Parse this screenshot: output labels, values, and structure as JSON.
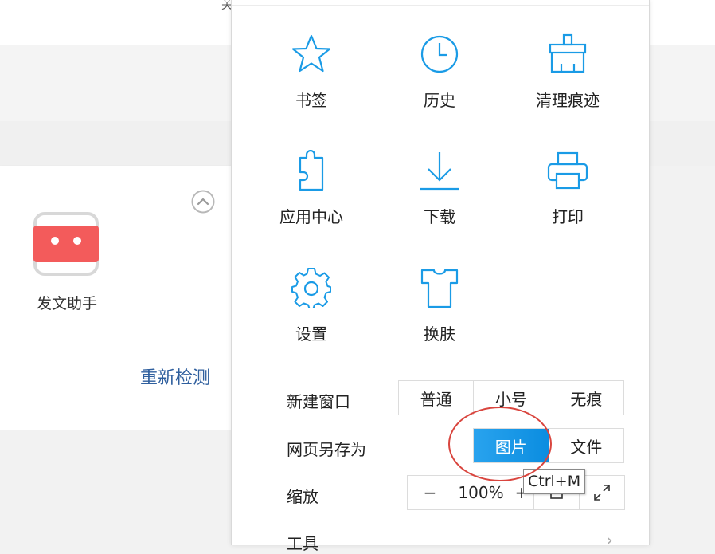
{
  "background": {
    "top_glyph": "关",
    "app": {
      "label": "发文助手",
      "icon": "robot-icon"
    },
    "recheck_label": "重新检测"
  },
  "menu": {
    "items": [
      {
        "label": "书签",
        "icon": "star-icon"
      },
      {
        "label": "历史",
        "icon": "clock-icon"
      },
      {
        "label": "清理痕迹",
        "icon": "broom-icon"
      },
      {
        "label": "应用中心",
        "icon": "puzzle-icon"
      },
      {
        "label": "下载",
        "icon": "download-icon"
      },
      {
        "label": "打印",
        "icon": "printer-icon"
      },
      {
        "label": "设置",
        "icon": "gear-icon"
      },
      {
        "label": "换肤",
        "icon": "tshirt-icon"
      }
    ],
    "new_window": {
      "label": "新建窗口",
      "options": [
        "普通",
        "小号",
        "无痕"
      ]
    },
    "save_as": {
      "label": "网页另存为",
      "options": [
        "图片",
        "文件"
      ],
      "selected": "图片"
    },
    "zoom": {
      "label": "缩放",
      "minus": "−",
      "value": "100%",
      "plus": "+",
      "shortcut_tooltip": "Ctrl+M"
    },
    "tools": {
      "label": "工具"
    }
  },
  "colors": {
    "icon_blue": "#1a9be6",
    "accent": "#0b8de0",
    "highlight": "#d9453e",
    "link": "#2f5f9e",
    "robot_red": "#f35b5b"
  }
}
